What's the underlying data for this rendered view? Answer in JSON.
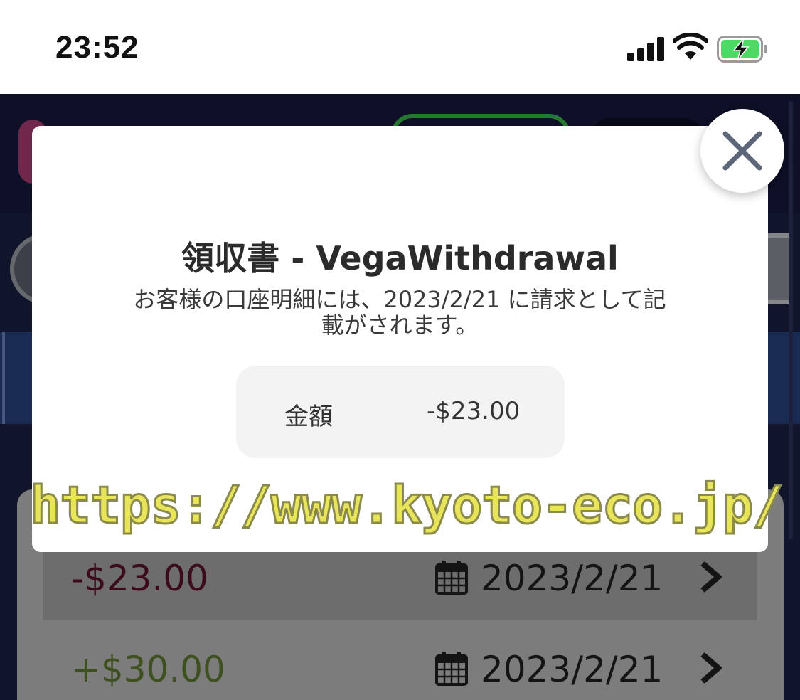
{
  "status_bar": {
    "time": "23:52",
    "icons": [
      "signal-icon",
      "wifi-icon",
      "battery-charging-icon"
    ]
  },
  "list": {
    "rows": [
      {
        "amount": "-$23.00",
        "date": "2023/2/21",
        "type": "negative"
      },
      {
        "amount": "+$30.00",
        "date": "2023/2/21",
        "type": "positive"
      }
    ]
  },
  "modal": {
    "title": "領収書 - VegaWithdrawal",
    "description": "お客様の口座明細には、2023/2/21 に請求として記載がされます。",
    "amount_label": "金額",
    "amount_value": "-$23.00",
    "close_icon": "close-icon"
  },
  "watermark": "https://www.kyoto-eco.jp/",
  "colors": {
    "negative": "#5a1228",
    "positive": "#5e7a2f",
    "header_bg": "#15193a",
    "band": "#27407e"
  }
}
